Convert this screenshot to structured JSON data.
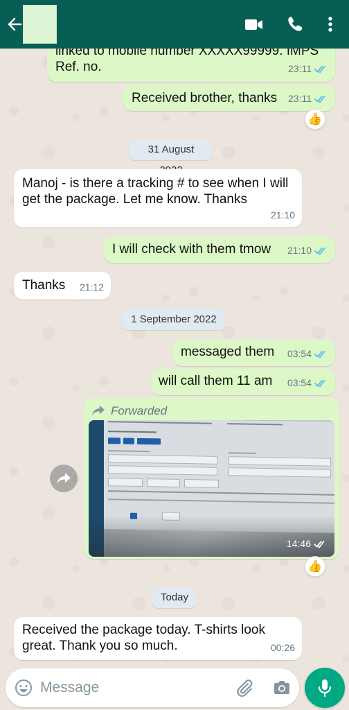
{
  "header": {
    "icons": [
      "back-arrow-icon",
      "video-call-icon",
      "phone-call-icon",
      "more-vert-icon"
    ],
    "colors": {
      "bar": "#075e54",
      "icon": "#ffffff"
    }
  },
  "messages": {
    "m1": {
      "text": "linked to mobile number XXXXX99999. IMPS Ref. no.",
      "time": "23:11",
      "status": "read"
    },
    "m2": {
      "text": "Received brother, thanks",
      "time": "23:11",
      "status": "read",
      "reaction": "👍"
    },
    "date1": "31 August 2022",
    "m3": {
      "text": "Manoj - is there a tracking # to see when I will get the package. Let me know. Thanks",
      "time": "21:10"
    },
    "m4": {
      "text": "I will check with them tmow",
      "time": "21:10",
      "status": "read"
    },
    "m5": {
      "text": "Thanks",
      "time": "21:12"
    },
    "date2": "1 September 2022",
    "m6": {
      "text": "messaged them",
      "time": "03:54",
      "status": "read"
    },
    "m7": {
      "text": "will call them 11 am",
      "time": "03:54",
      "status": "read"
    },
    "m8": {
      "forwarded_label": "Forwarded",
      "time": "14:46",
      "status": "read",
      "reaction": "👍"
    },
    "date3": "Today",
    "m9": {
      "text": "Received the package today. T-shirts look great. Thank you so much.",
      "time": "00:26"
    }
  },
  "composer": {
    "placeholder": "Message",
    "icons": [
      "emoji-icon",
      "attach-icon",
      "camera-icon",
      "mic-icon"
    ]
  },
  "colors": {
    "outgoing_bubble": "#dcf8c6",
    "incoming_bubble": "#ffffff",
    "read_ticks": "#53bdeb",
    "mic_button": "#00a884",
    "chat_background": "#ece5dd"
  }
}
